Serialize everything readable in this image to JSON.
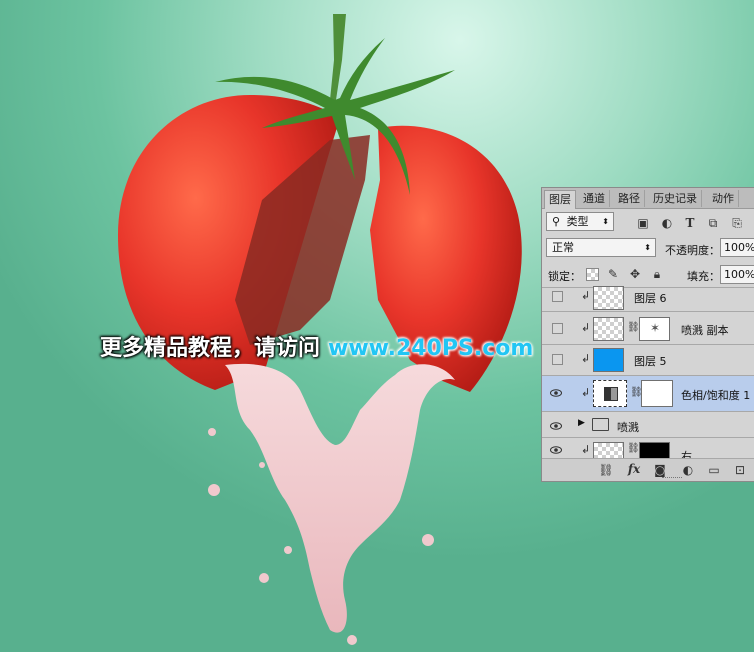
{
  "watermark": {
    "text_cn": "更多精品教程，请访问",
    "url": "www.240PS.com"
  },
  "colors": {
    "background_center": "#d8f6ea",
    "background_edge": "#58b08e",
    "tomato": "#e8352a",
    "milk": "#f3cfd2",
    "panel_bg": "#d4d4d4",
    "selected_row": "#b9cdec",
    "layer5_fill": "#0a96f0",
    "url_color": "#22c6f4"
  },
  "layers_panel": {
    "tabs": [
      "图层",
      "通道",
      "路径",
      "历史记录",
      "动作"
    ],
    "active_tab": "图层",
    "filter": {
      "label": "类型",
      "icon": "search-icon"
    },
    "filter_icons": [
      "image-filter-icon",
      "adjustment-filter-icon",
      "text-filter-icon",
      "shape-filter-icon",
      "smart-object-filter-icon"
    ],
    "blend_mode": "正常",
    "opacity_label": "不透明度：",
    "opacity_value": "100%",
    "lock_label": "锁定：",
    "lock_icons": [
      "lock-transparent-icon",
      "lock-paint-icon",
      "lock-move-icon",
      "lock-all-icon"
    ],
    "fill_label": "填充：",
    "fill_value": "100%",
    "layers": [
      {
        "name": "图层 6",
        "visible": false,
        "clipped": true,
        "thumb": "checker"
      },
      {
        "name": "喷溅 副本",
        "visible": false,
        "clipped": true,
        "thumb": "checker",
        "has_mask": true
      },
      {
        "name": "图层 5",
        "visible": false,
        "clipped": true,
        "thumb": "blue"
      },
      {
        "name": "色相/饱和度 1",
        "visible": true,
        "clipped": true,
        "thumb": "adjustment",
        "has_mask": true,
        "selected": true
      },
      {
        "name": "喷溅",
        "visible": true,
        "group": true
      },
      {
        "name": "右",
        "visible": true,
        "clipped": true,
        "thumb": "checker",
        "has_mask": true
      }
    ],
    "footer_icons": [
      "link-layers-icon",
      "fx-icon",
      "add-mask-icon",
      "adjustment-layer-icon",
      "new-group-icon",
      "new-layer-icon"
    ],
    "footer_fx": "fx"
  }
}
